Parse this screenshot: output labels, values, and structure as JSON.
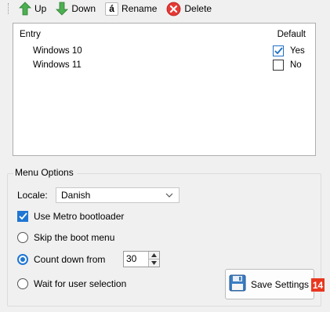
{
  "toolbar": {
    "up_label": "Up",
    "down_label": "Down",
    "rename_glyph": "á",
    "rename_label": "Rename",
    "delete_label": "Delete"
  },
  "entries": {
    "headers": {
      "entry": "Entry",
      "default": "Default"
    },
    "rows": [
      {
        "name": "Windows 10",
        "default": "Yes",
        "checked": true
      },
      {
        "name": "Windows 11",
        "default": "No",
        "checked": false
      }
    ]
  },
  "menu_options": {
    "title": "Menu Options",
    "locale_label": "Locale:",
    "locale_value": "Danish",
    "metro_label": "Use Metro bootloader",
    "metro_checked": true,
    "skip_label": "Skip the boot menu",
    "countdown_label": "Count down from",
    "countdown_value": "30",
    "wait_label": "Wait for user selection",
    "selected_option": "countdown"
  },
  "save_button": {
    "label": "Save Settings"
  },
  "badge": {
    "number": "14"
  },
  "colors": {
    "accent": "#1f76d2",
    "badge": "#e8371f",
    "up_arrow": "#4caf50",
    "down_arrow": "#4caf50",
    "delete": "#e53935"
  }
}
